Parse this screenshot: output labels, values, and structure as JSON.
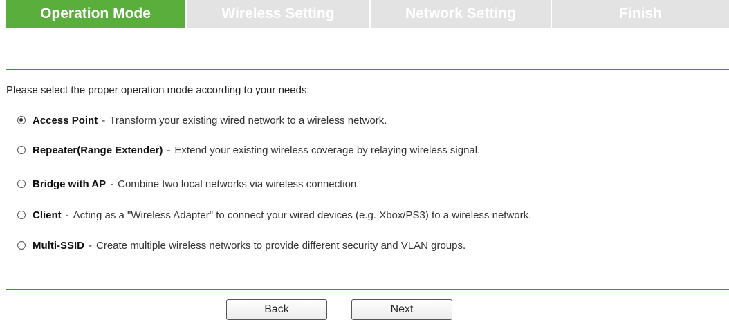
{
  "tabs": [
    {
      "label": "Operation Mode",
      "active": true
    },
    {
      "label": "Wireless Setting",
      "active": false
    },
    {
      "label": "Network Setting",
      "active": false
    },
    {
      "label": "Finish",
      "active": false
    }
  ],
  "colors": {
    "active_tab": "#5aae3c",
    "inactive_tab": "#e3e3e3",
    "rule": "#4a8c4a"
  },
  "prompt": "Please select the proper operation mode according to your needs:",
  "options": [
    {
      "name": "Access Point",
      "sep": "-",
      "desc": "Transform your existing wired network to a wireless network.",
      "selected": true
    },
    {
      "name": "Repeater(Range Extender)",
      "sep": "-",
      "desc": "Extend your existing wireless coverage by relaying wireless signal.",
      "selected": false
    },
    {
      "name": "Bridge with AP",
      "sep": "-",
      "desc": "Combine two local networks via wireless connection.",
      "selected": false
    },
    {
      "name": "Client",
      "sep": "-",
      "desc": "Acting as a \"Wireless Adapter\" to connect your wired devices (e.g. Xbox/PS3) to a wireless network.",
      "selected": false
    },
    {
      "name": "Multi-SSID",
      "sep": "-",
      "desc": "Create multiple wireless networks to provide different security and VLAN groups.",
      "selected": false
    }
  ],
  "buttons": {
    "back": "Back",
    "next": "Next"
  }
}
